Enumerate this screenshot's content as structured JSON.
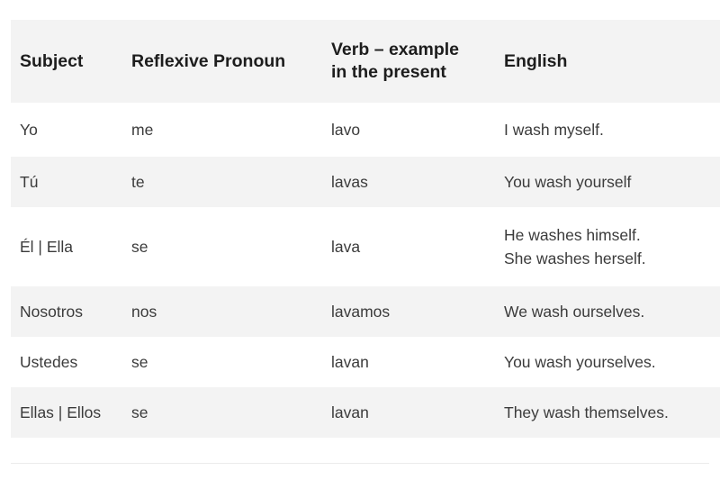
{
  "table": {
    "headers": [
      "Subject",
      "Reflexive Pronoun",
      "Verb – example\nin the present",
      "English"
    ],
    "header_verb_line1": "Verb – example",
    "header_verb_line2": "in the present",
    "rows": [
      {
        "subject": "Yo",
        "pronoun": "me",
        "verb": "lavo",
        "english_line1": "I wash myself.",
        "english_line2": ""
      },
      {
        "subject": "Tú",
        "pronoun": "te",
        "verb": "lavas",
        "english_line1": "You wash yourself",
        "english_line2": ""
      },
      {
        "subject": "Él | Ella",
        "pronoun": "se",
        "verb": "lava",
        "english_line1": "He washes himself.",
        "english_line2": "She washes herself."
      },
      {
        "subject": "Nosotros",
        "pronoun": "nos",
        "verb": "lavamos",
        "english_line1": "We wash ourselves.",
        "english_line2": ""
      },
      {
        "subject": "Ustedes",
        "pronoun": "se",
        "verb": "lavan",
        "english_line1": "You wash yourselves.",
        "english_line2": ""
      },
      {
        "subject": "Ellas | Ellos",
        "pronoun": "se",
        "verb": "lavan",
        "english_line1": "They wash themselves.",
        "english_line2": ""
      }
    ],
    "colors": {
      "header_background": "#f3f3f3",
      "shaded_row_background": "#f3f3f3",
      "plain_row_background": "#ffffff",
      "header_text": "#1d1d1d",
      "body_text": "#3b3b3b",
      "rule": "#ececec"
    }
  }
}
